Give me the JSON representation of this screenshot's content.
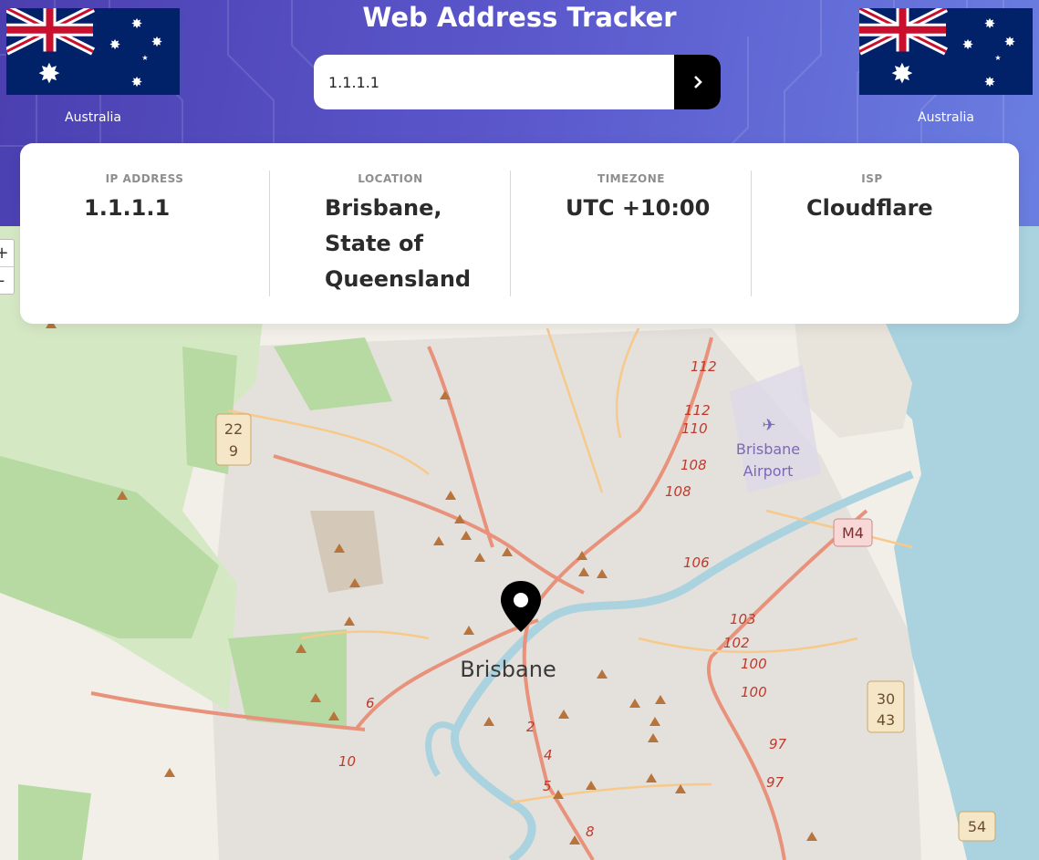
{
  "header": {
    "title": "Web Address Tracker"
  },
  "search": {
    "value": "1.1.1.1"
  },
  "flags": {
    "left_label": "Australia",
    "right_label": "Australia"
  },
  "info": {
    "ip_label": "IP ADDRESS",
    "ip_value": "1.1.1.1",
    "location_label": "LOCATION",
    "location_line1": "Brisbane,",
    "location_line2": "State of",
    "location_line3": "Queensland",
    "timezone_label": "TIMEZONE",
    "timezone_value": "UTC +10:00",
    "isp_label": "ISP",
    "isp_value": "Cloudflare"
  },
  "map": {
    "zoom_in": "+",
    "zoom_out": "-",
    "city_label": "Brisbane",
    "airport_label_1": "Brisbane",
    "airport_label_2": "Airport",
    "route_labels": [
      "112",
      "112",
      "110",
      "108",
      "108",
      "106",
      "103",
      "102",
      "100",
      "100",
      "97",
      "97",
      "6",
      "10",
      "2",
      "4",
      "5",
      "8"
    ],
    "shields": [
      "22",
      "9",
      "M4",
      "30",
      "43",
      "54"
    ]
  },
  "colors": {
    "accent": "#5b58cc",
    "land": "#f2efe9",
    "water": "#aad3df",
    "park": "#c8e6b4",
    "road_major": "#e8927c",
    "road_minor": "#f7c98a"
  }
}
